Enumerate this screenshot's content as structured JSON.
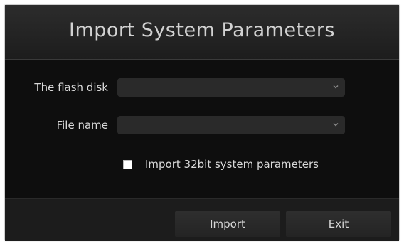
{
  "dialog": {
    "title": "Import System Parameters",
    "flash_disk": {
      "label": "The flash disk",
      "value": ""
    },
    "file_name": {
      "label": "File name",
      "value": ""
    },
    "import_32bit": {
      "label": "Import 32bit system parameters",
      "checked": false
    },
    "buttons": {
      "import_label": "Import",
      "exit_label": "Exit"
    }
  },
  "icons": {
    "dropdown": "chevron-down-icon"
  },
  "colors": {
    "background": "#0e0e0e",
    "title_bar": "#262626",
    "field": "#2a2a2a",
    "footer": "#1c1c1c",
    "text": "#d9d9d9"
  }
}
